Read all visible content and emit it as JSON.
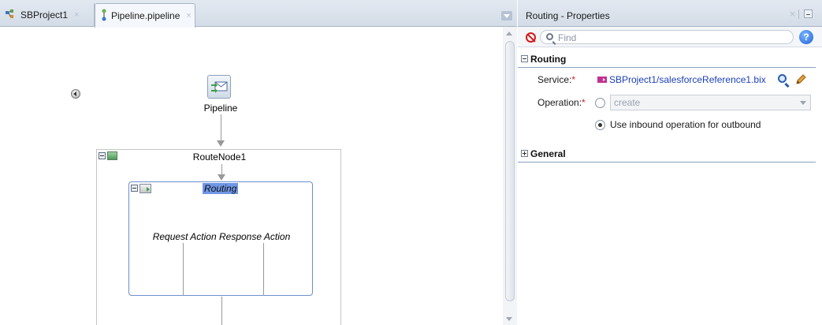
{
  "editor": {
    "tabs": [
      {
        "label": "SBProject1",
        "close": "×"
      },
      {
        "label": "Pipeline.pipeline",
        "close": "×"
      }
    ],
    "canvas": {
      "pipeline_label": "Pipeline",
      "route_node_label": "RouteNode1",
      "routing_label": "Routing",
      "actions_label": "Request Action Response Action"
    }
  },
  "properties": {
    "title": "Routing - Properties",
    "close": "×",
    "find_placeholder": "Find",
    "help": "?",
    "routing_section": {
      "title": "Routing",
      "service_label": "Service:",
      "required_mark": "*",
      "service_value": "SBProject1/salesforceReference1.bix",
      "operation_label": "Operation:",
      "operation_value": "create",
      "inbound_option": "Use inbound operation for outbound"
    },
    "general_section": {
      "title": "General"
    }
  },
  "colors": {
    "accent": "#6f96e6",
    "link": "#1c3fb8",
    "required": "#d51b1b",
    "tab_bar": "#d3dce7"
  }
}
